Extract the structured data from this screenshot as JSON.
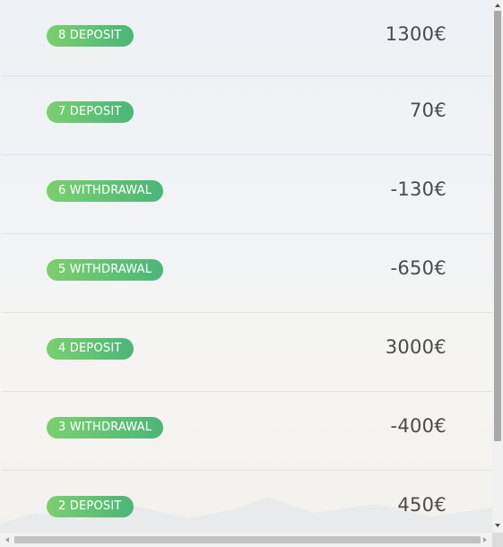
{
  "transactions": [
    {
      "label": "8 DEPOSIT",
      "amount": "1300€"
    },
    {
      "label": "7 DEPOSIT",
      "amount": "70€"
    },
    {
      "label": "6 WITHDRAWAL",
      "amount": "-130€"
    },
    {
      "label": "5 WITHDRAWAL",
      "amount": "-650€"
    },
    {
      "label": "4 DEPOSIT",
      "amount": "3000€"
    },
    {
      "label": "3 WITHDRAWAL",
      "amount": "-400€"
    },
    {
      "label": "2 DEPOSIT",
      "amount": "450€"
    }
  ],
  "colors": {
    "badge_start": "#7ccf6f",
    "badge_end": "#4cb57a",
    "amount_text": "#4a4a4a"
  }
}
